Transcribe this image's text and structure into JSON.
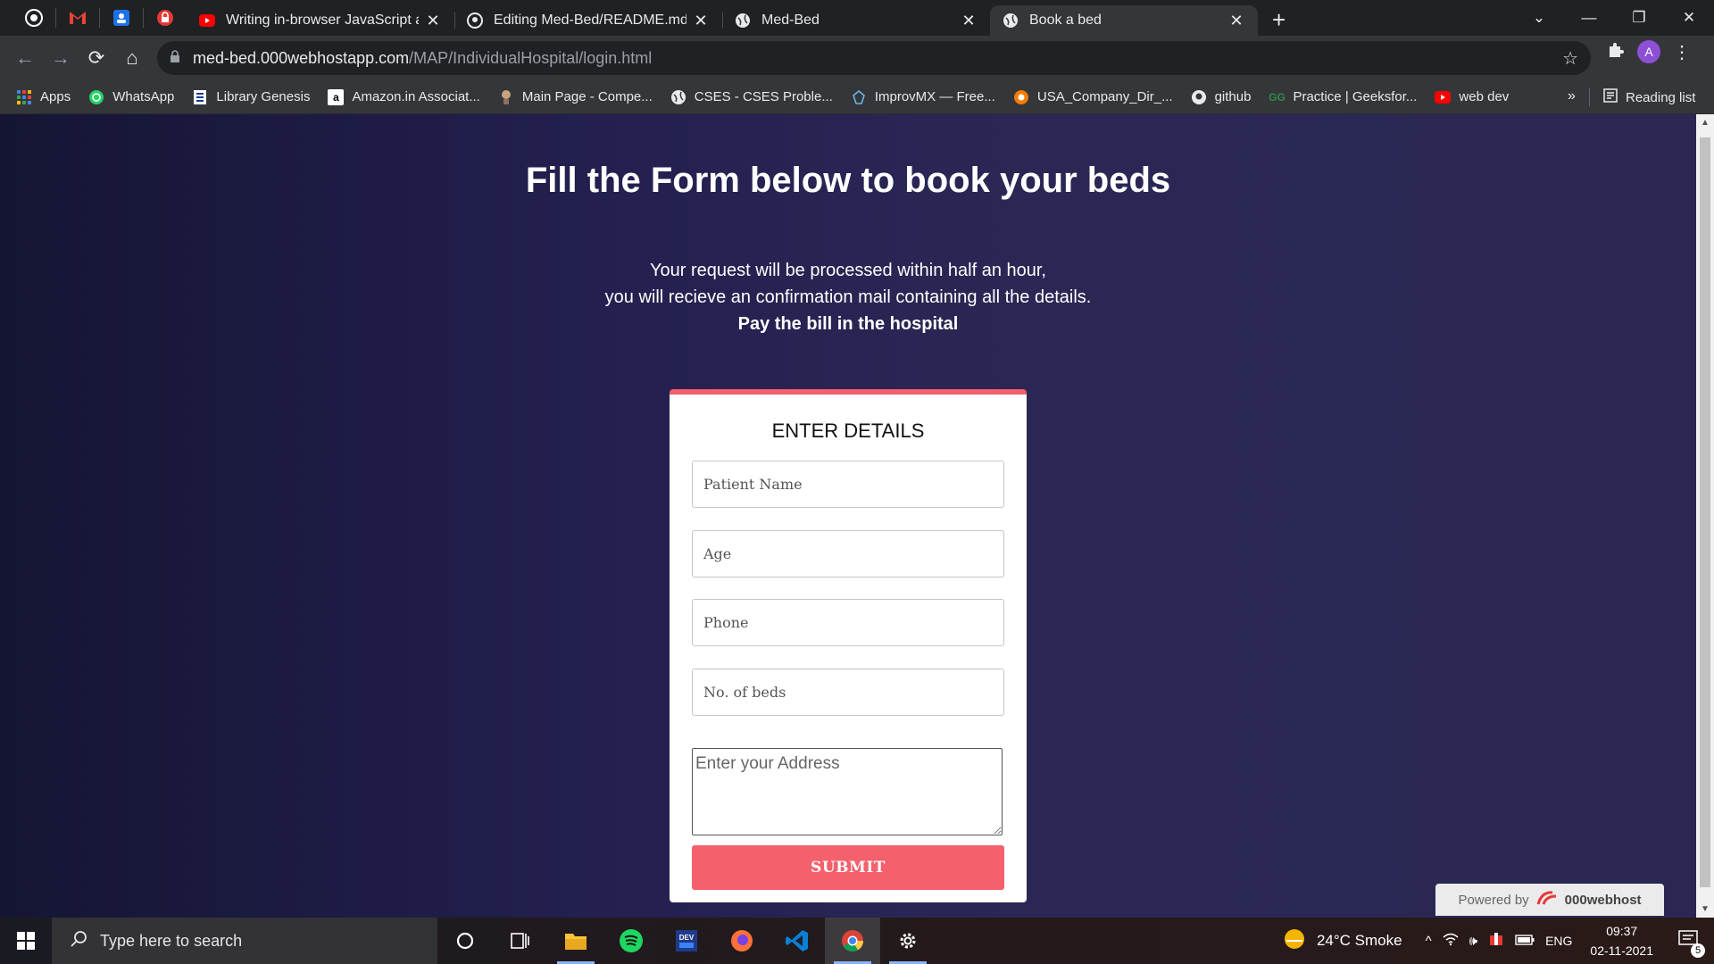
{
  "browser": {
    "tabs": [
      {
        "label": "Writing in-browser JavaScript and",
        "icon": "youtube-icon"
      },
      {
        "label": "Editing Med-Bed/README.md at",
        "icon": "github-icon"
      },
      {
        "label": "Med-Bed",
        "icon": "globe-icon"
      },
      {
        "label": "Book a bed",
        "icon": "globe-icon",
        "active": true
      }
    ],
    "url_host": "med-bed.000webhostapp.com",
    "url_path": "/MAP/IndividualHospital/login.html",
    "avatar_letter": "A",
    "bookmarks": [
      {
        "label": "Apps"
      },
      {
        "label": "WhatsApp"
      },
      {
        "label": "Library Genesis"
      },
      {
        "label": "Amazon.in Associat..."
      },
      {
        "label": "Main Page - Compe..."
      },
      {
        "label": "CSES - CSES Proble..."
      },
      {
        "label": "ImprovMX — Free..."
      },
      {
        "label": "USA_Company_Dir_..."
      },
      {
        "label": "github"
      },
      {
        "label": "Practice | Geeksfor..."
      },
      {
        "label": "web dev"
      }
    ],
    "bookmarks_more": "»",
    "reading_list": "Reading list"
  },
  "page": {
    "heading": "Fill the Form below to book your beds",
    "info_line1": "Your request will be processed within half an hour,",
    "info_line2": "you will recieve an confirmation mail containing all the details.",
    "info_line3": "Pay the bill in the hospital",
    "form": {
      "title": "ENTER DETAILS",
      "patient_name_placeholder": "Patient Name",
      "age_placeholder": "Age",
      "phone_placeholder": "Phone",
      "beds_placeholder": "No. of beds",
      "address_placeholder": "Enter your Address",
      "submit_label": "SUBMIT"
    },
    "powered_by": "Powered by",
    "powered_brand": "000webhost",
    "accent_color": "#f4606c"
  },
  "taskbar": {
    "search_placeholder": "Type here to search",
    "weather": "24°C  Smoke",
    "language": "ENG",
    "time": "09:37",
    "date": "02-11-2021",
    "notification_count": "5"
  }
}
